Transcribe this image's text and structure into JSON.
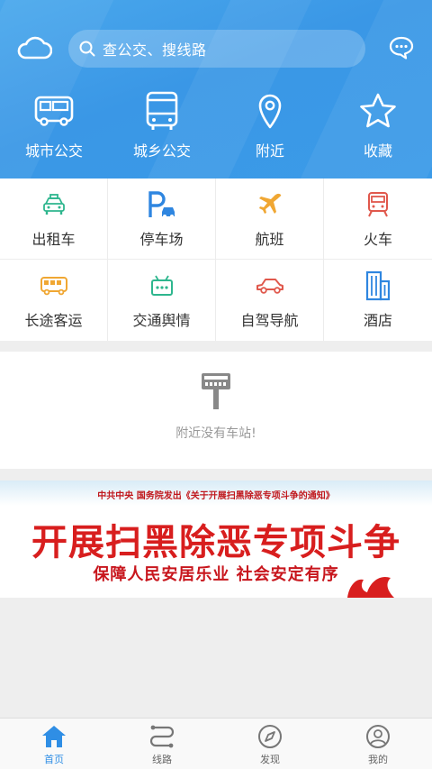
{
  "header": {
    "search_placeholder": "查公交、搜线路",
    "quick_items": [
      {
        "label": "城市公交",
        "icon": "bus-icon"
      },
      {
        "label": "城乡公交",
        "icon": "coach-icon"
      },
      {
        "label": "附近",
        "icon": "location-pin-icon"
      },
      {
        "label": "收藏",
        "icon": "star-icon"
      }
    ]
  },
  "grid": [
    {
      "label": "出租车",
      "icon": "taxi-icon",
      "color": "#2eb68e"
    },
    {
      "label": "停车场",
      "icon": "parking-icon",
      "color": "#2f86e0"
    },
    {
      "label": "航班",
      "icon": "airplane-icon",
      "color": "#f0a733"
    },
    {
      "label": "火车",
      "icon": "train-icon",
      "color": "#e0584c"
    },
    {
      "label": "长途客运",
      "icon": "long-bus-icon",
      "color": "#f0a733"
    },
    {
      "label": "交通舆情",
      "icon": "traffic-info-icon",
      "color": "#2eb68e"
    },
    {
      "label": "自驾导航",
      "icon": "car-icon",
      "color": "#e0584c"
    },
    {
      "label": "酒店",
      "icon": "hotel-icon",
      "color": "#2f86e0"
    }
  ],
  "nearby": {
    "empty_text": "附近没有车站!"
  },
  "banner": {
    "subtitle": "中共中央 国务院发出《关于开展扫黑除恶专项斗争的通知》",
    "title": "开展扫黑除恶专项斗争",
    "slogan": "保障人民安居乐业 社会安定有序"
  },
  "tabs": [
    {
      "label": "首页",
      "icon": "home-icon",
      "active": true
    },
    {
      "label": "线路",
      "icon": "route-icon",
      "active": false
    },
    {
      "label": "发现",
      "icon": "compass-icon",
      "active": false
    },
    {
      "label": "我的",
      "icon": "user-icon",
      "active": false
    }
  ],
  "colors": {
    "header_blue": "#3a97e6",
    "active_tab": "#2f8ee5"
  }
}
